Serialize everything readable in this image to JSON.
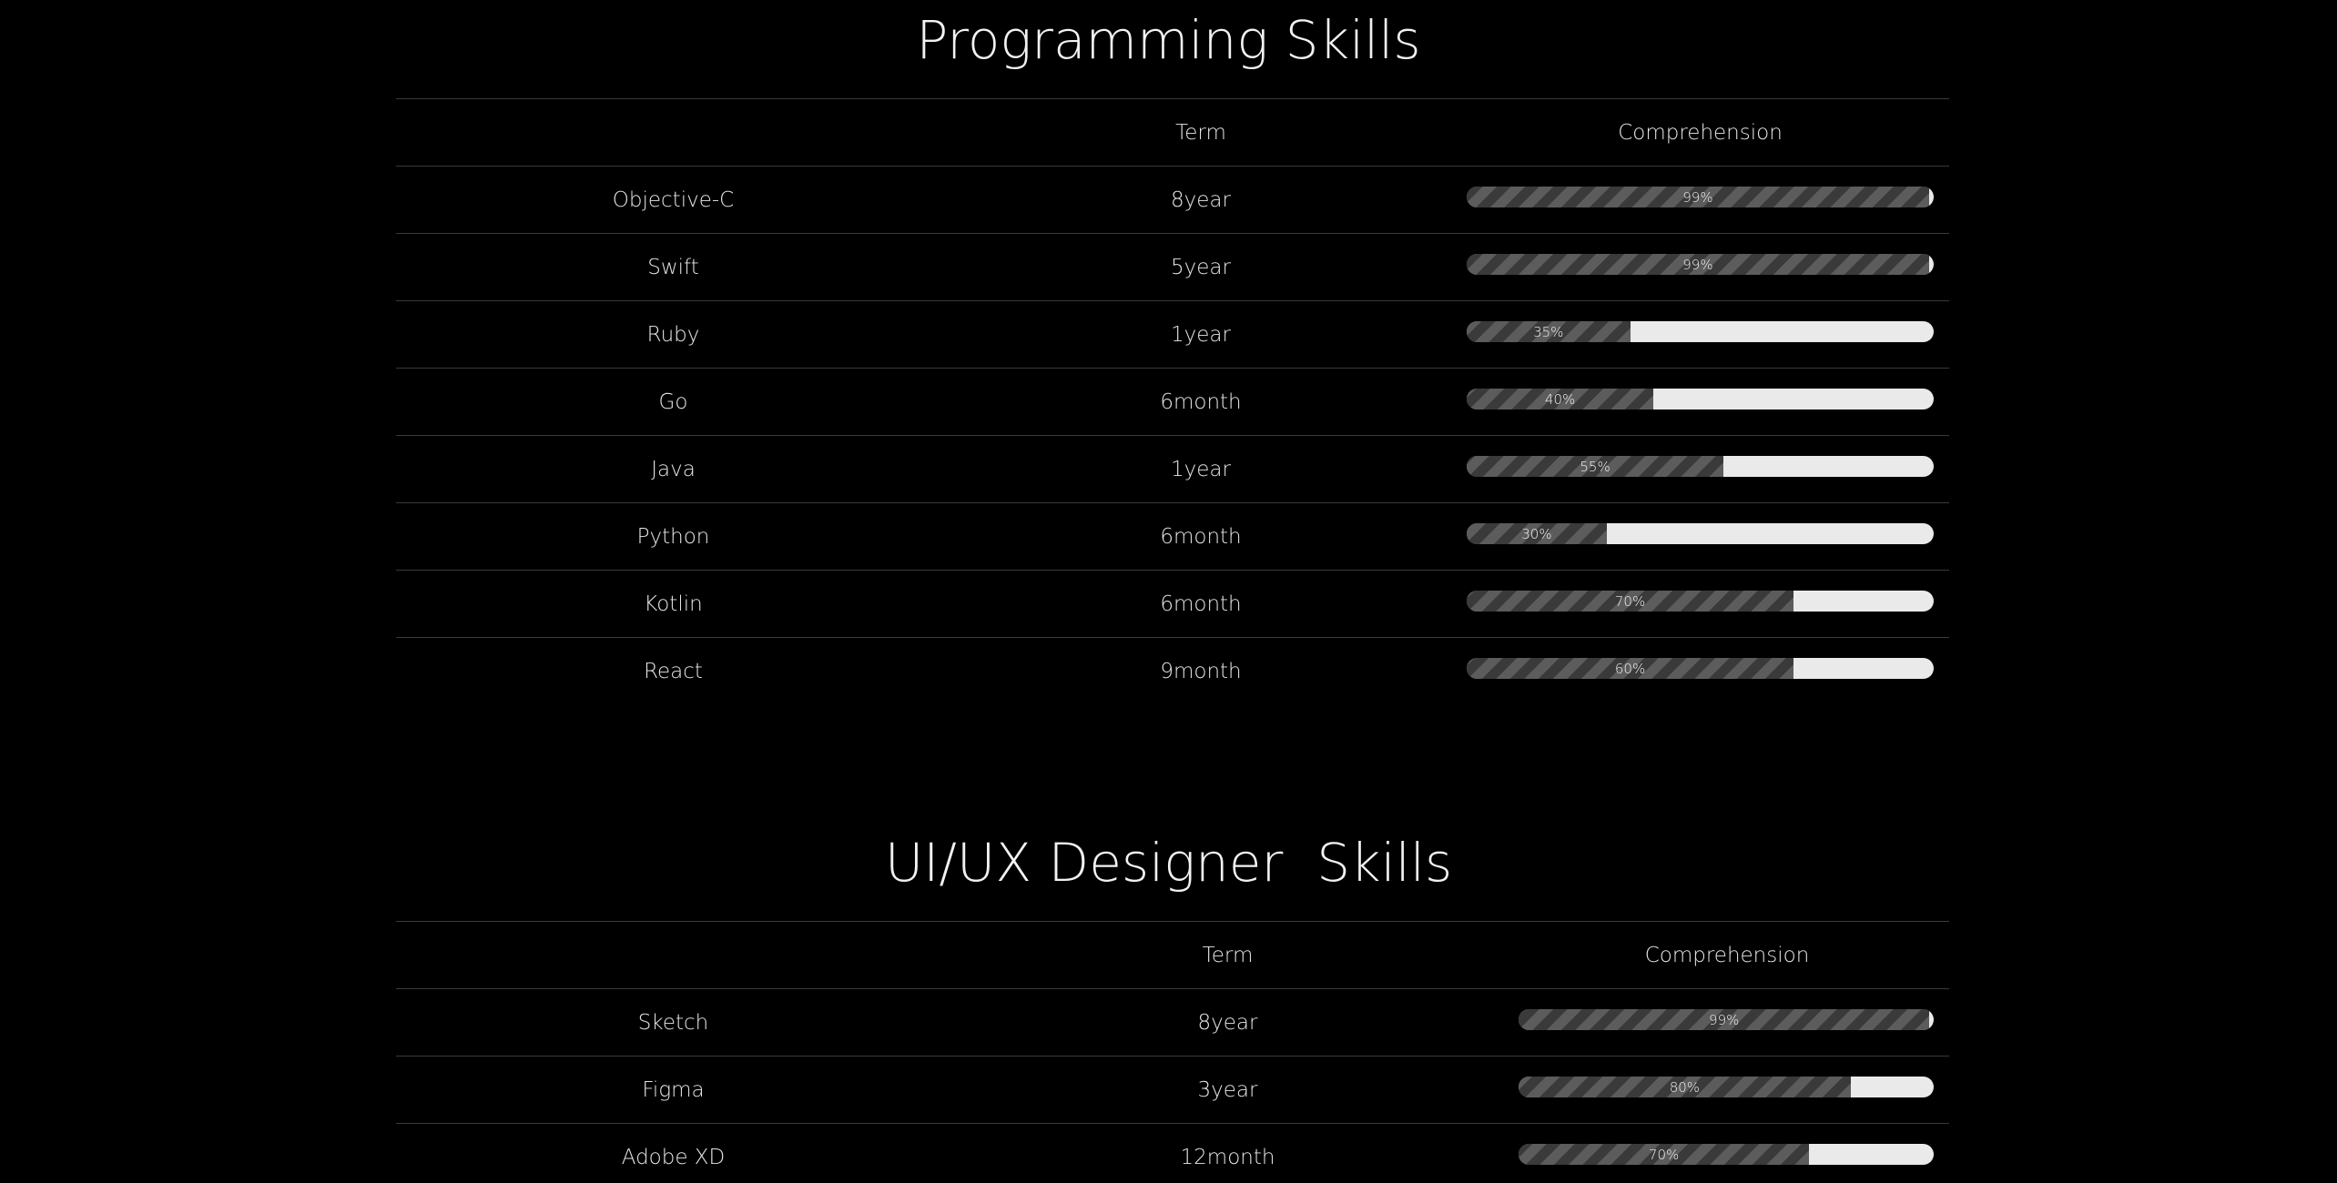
{
  "programming": {
    "title": "Programming Skills",
    "header": {
      "term": "Term",
      "comprehension": "Comprehension"
    },
    "rows": [
      {
        "name": "Objective-C",
        "term": "8year",
        "percent": 99,
        "label": "99%"
      },
      {
        "name": "Swift",
        "term": "5year",
        "percent": 99,
        "label": "99%"
      },
      {
        "name": "Ruby",
        "term": "1year",
        "percent": 35,
        "label": "35%"
      },
      {
        "name": "Go",
        "term": "6month",
        "percent": 40,
        "label": "40%"
      },
      {
        "name": "Java",
        "term": "1year",
        "percent": 55,
        "label": "55%"
      },
      {
        "name": "Python",
        "term": "6month",
        "percent": 30,
        "label": "30%"
      },
      {
        "name": "Kotlin",
        "term": "6month",
        "percent": 70,
        "label": "70%"
      },
      {
        "name": "React",
        "term": "9month",
        "percent": 70,
        "label": "60%"
      }
    ]
  },
  "design": {
    "title": "UI/UX Designer  Skills",
    "header": {
      "term": "Term",
      "comprehension": "Comprehension"
    },
    "rows": [
      {
        "name": "Sketch",
        "term": "8year",
        "percent": 99,
        "label": "99%"
      },
      {
        "name": "Figma",
        "term": "3year",
        "percent": 80,
        "label": "80%"
      },
      {
        "name": "Adobe XD",
        "term": "12month",
        "percent": 70,
        "label": "70%"
      }
    ]
  },
  "colors": {
    "background": "#000000",
    "text": "#e6e6e6",
    "bar_track": "#eaeaea",
    "bar_fill": "#3b3b3b",
    "bar_stripe": "#5c5c5c",
    "divider": "#3a3a3a"
  }
}
